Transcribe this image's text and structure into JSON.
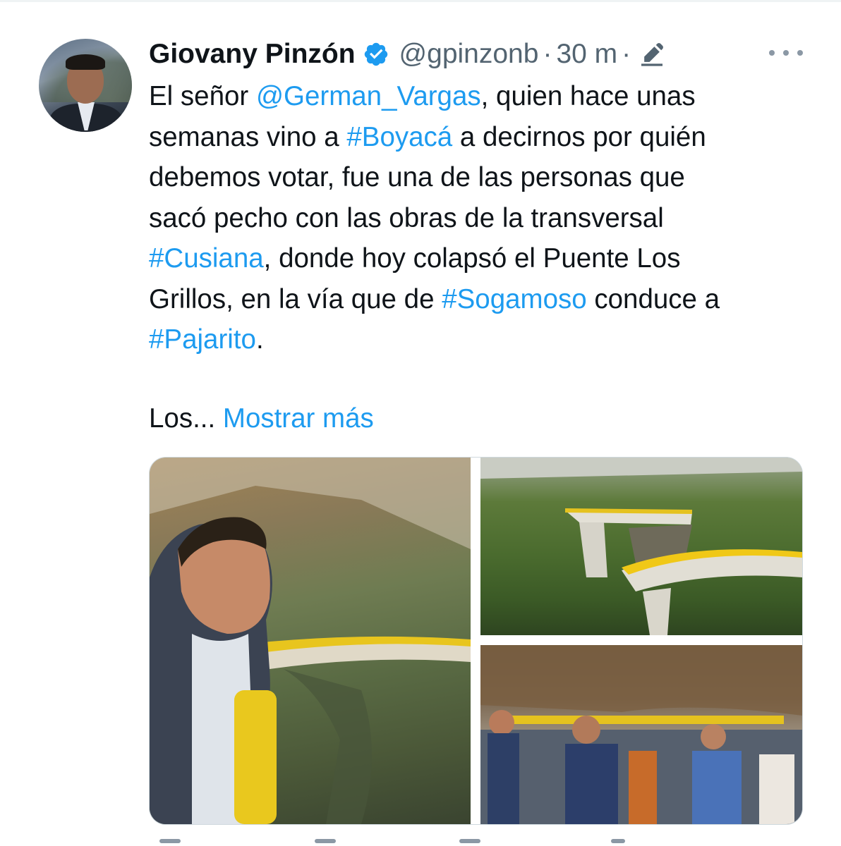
{
  "tweet": {
    "author_name": "Giovany Pinzón",
    "handle": "@gpinzonb",
    "separator": "·",
    "time": "30 m",
    "lines": [
      {
        "segments": [
          {
            "text": "El señor ",
            "link": false
          },
          {
            "text": "@German_Vargas",
            "link": true
          },
          {
            "text": ", quien hace unas",
            "link": false
          }
        ]
      },
      {
        "segments": [
          {
            "text": "semanas vino a ",
            "link": false
          },
          {
            "text": "#Boyacá",
            "link": true
          },
          {
            "text": " a decirnos por quién",
            "link": false
          }
        ]
      },
      {
        "segments": [
          {
            "text": "debemos votar, fue una de las personas que",
            "link": false
          }
        ]
      },
      {
        "segments": [
          {
            "text": "sacó pecho con las obras de la transversal",
            "link": false
          }
        ]
      },
      {
        "segments": [
          {
            "text": "#Cusiana",
            "link": true
          },
          {
            "text": ", donde hoy colapsó el Puente Los",
            "link": false
          }
        ]
      },
      {
        "segments": [
          {
            "text": "Grillos, en la vía que de ",
            "link": false
          },
          {
            "text": "#Sogamoso",
            "link": true
          },
          {
            "text": " conduce a",
            "link": false
          }
        ]
      },
      {
        "segments": [
          {
            "text": "#Pajarito",
            "link": true
          },
          {
            "text": ".",
            "link": false
          }
        ]
      }
    ],
    "truncated_text": "Los... ",
    "show_more_label": "Mostrar más"
  },
  "icons": {
    "verified": "verified-badge-icon",
    "edit": "edited-pencil-icon",
    "more": "more-options-icon"
  },
  "colors": {
    "link": "#1d9bf0",
    "secondary_text": "#536471",
    "primary_text": "#0f1419",
    "verified_badge": "#1d9bf0"
  }
}
